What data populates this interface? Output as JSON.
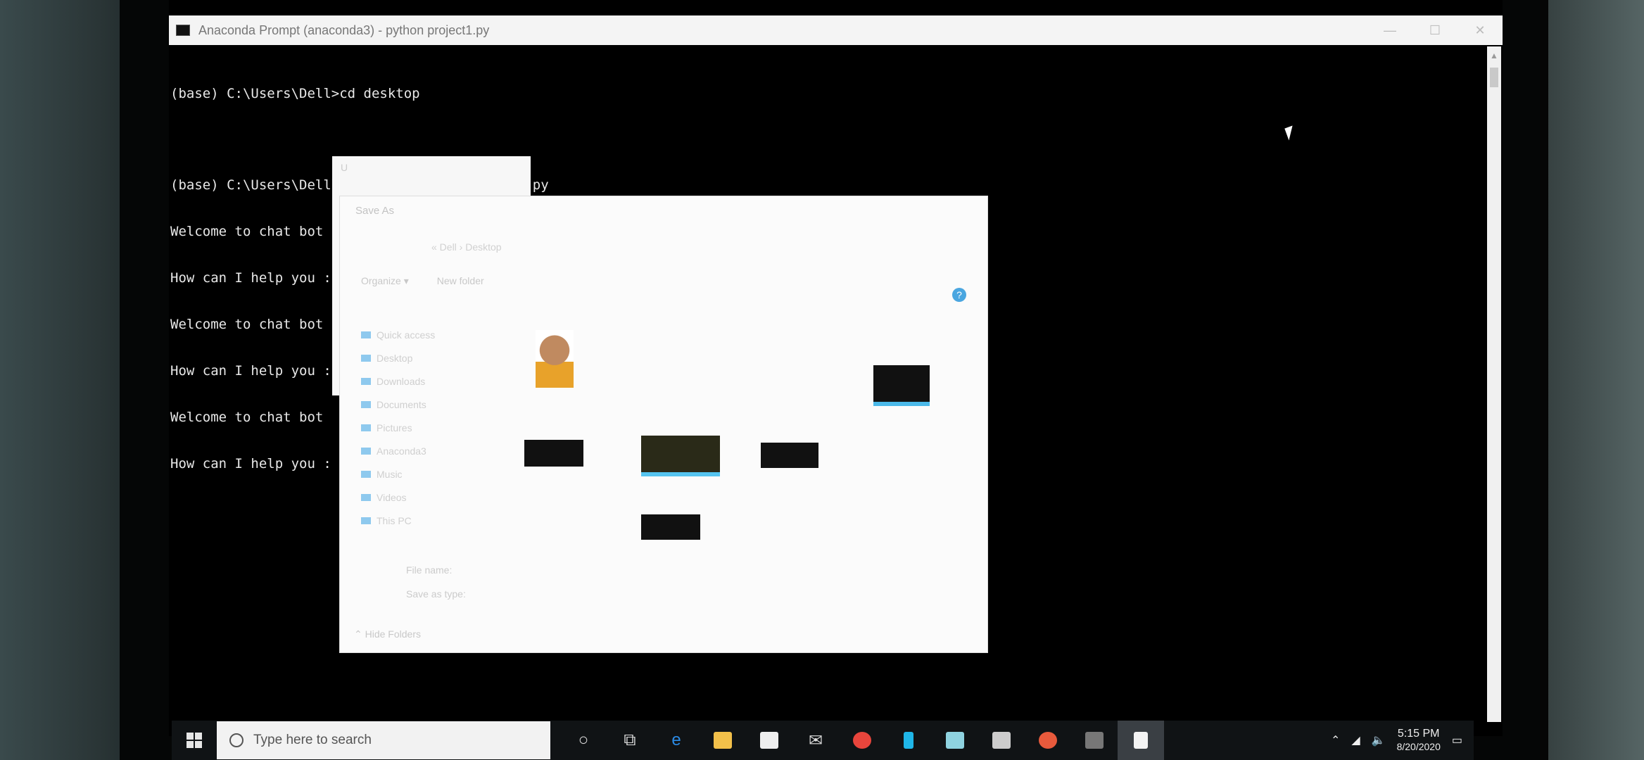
{
  "window": {
    "title": "Anaconda Prompt (anaconda3) - python project1.py",
    "controls": [
      "—",
      "☐",
      "✕"
    ]
  },
  "terminal": {
    "lines": [
      "(base) C:\\Users\\Dell>cd desktop",
      "",
      "(base) C:\\Users\\Dell\\Desktop>python project1.py",
      "Welcome to chat bot",
      "How can I help you : open chrome",
      "Welcome to chat bot",
      "How can I help you : open notepad",
      "Welcome to chat bot",
      "How can I help you :"
    ]
  },
  "notepad": {
    "title": "U"
  },
  "dialog": {
    "title": "Save As",
    "path": "« Dell › Desktop",
    "toolbar": [
      "Organize ▾",
      "New folder"
    ],
    "nav": [
      "Quick access",
      "Desktop",
      "Downloads",
      "Documents",
      "Pictures",
      "Anaconda3",
      "Music",
      "Videos",
      "This PC"
    ],
    "fields": [
      "File name:",
      "Save as type:"
    ],
    "hide_folders": "Hide Folders"
  },
  "taskbar": {
    "search_placeholder": "Type here to search",
    "time": "5:15 PM",
    "date": "8/20/2020"
  }
}
